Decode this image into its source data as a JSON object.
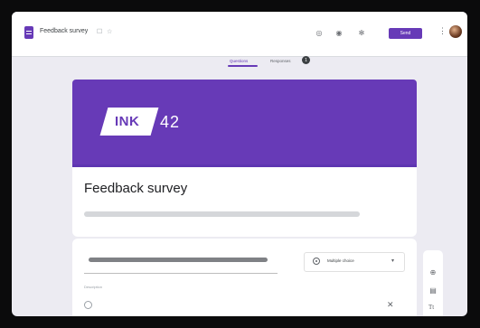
{
  "app": {
    "doc_title": "Feedback survey",
    "title_icons": [
      "folder-icon",
      "star-icon"
    ]
  },
  "header_icons": [
    "customize-theme-icon",
    "preview-eye-icon",
    "settings-gear-icon"
  ],
  "send_label": "Send",
  "more_glyph": "⋮",
  "tabs": [
    {
      "label": "Questions",
      "selected": true
    },
    {
      "label": "Responses",
      "badge": "1"
    }
  ],
  "banner": {
    "logo_text": "INK",
    "logo_number": "42",
    "color": "#673ab7"
  },
  "form": {
    "title": "Feedback survey"
  },
  "question": {
    "type_label": "Multiple choice",
    "description_label": "Description",
    "caret": "▾",
    "remove_glyph": "✕"
  },
  "toolbar": {
    "icons": [
      "add-question-icon",
      "import-questions-icon",
      "add-title-icon"
    ],
    "title_glyph": "Tt"
  },
  "colors": {
    "accent": "#673ab7"
  }
}
